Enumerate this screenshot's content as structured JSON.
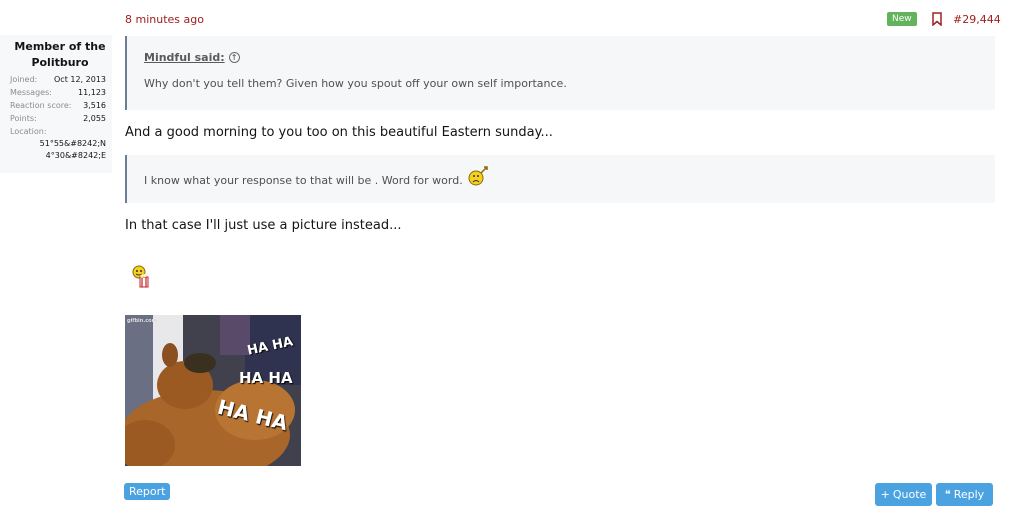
{
  "user": {
    "title": "Member of the Politburo",
    "stats": [
      {
        "key": "Joined:",
        "value": "Oct 12, 2013"
      },
      {
        "key": "Messages:",
        "value": "11,123"
      },
      {
        "key": "Reaction score:",
        "value": "3,516"
      },
      {
        "key": "Points:",
        "value": "2,055"
      }
    ],
    "location_label": "Location:",
    "location_line1": "51°55&#8242;N",
    "location_line2": "4°30&#8242;E"
  },
  "post": {
    "timestamp": "8 minutes ago",
    "new_badge": "New",
    "number": "#29,444",
    "quote1_author": "Mindful said:",
    "quote1_text": "Why don't you tell them? Given how you spout off your own self importance.",
    "line1": "And a good morning to you too on this beautiful Eastern sunday...",
    "quote2_text": "I know what your response to that will be . Word for word.",
    "line2": "In that case I'll just use a picture instead...",
    "gif_caption_small": "gifbin.com",
    "gif_text1": "HA HA",
    "gif_text2": "HA HA",
    "gif_text3": "HA HA"
  },
  "actions": {
    "report": "Report",
    "quote": "Quote",
    "reply": "Reply"
  },
  "colors": {
    "accent": "#4aa3e0",
    "link_red": "#a02020",
    "new_green": "#63b35c"
  }
}
